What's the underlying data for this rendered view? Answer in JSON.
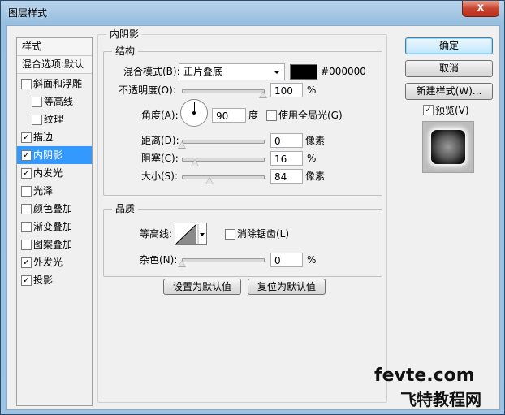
{
  "window": {
    "title": "图层样式",
    "close_label": "x"
  },
  "style_list": {
    "header": "样式",
    "blend_options": "混合选项:默认",
    "items": [
      {
        "label": "斜面和浮雕",
        "checked": false,
        "indent": false,
        "selected": false
      },
      {
        "label": "等高线",
        "checked": false,
        "indent": true,
        "selected": false
      },
      {
        "label": "纹理",
        "checked": false,
        "indent": true,
        "selected": false
      },
      {
        "label": "描边",
        "checked": true,
        "indent": false,
        "selected": false
      },
      {
        "label": "内阴影",
        "checked": true,
        "indent": false,
        "selected": true
      },
      {
        "label": "内发光",
        "checked": true,
        "indent": false,
        "selected": false
      },
      {
        "label": "光泽",
        "checked": false,
        "indent": false,
        "selected": false
      },
      {
        "label": "颜色叠加",
        "checked": false,
        "indent": false,
        "selected": false
      },
      {
        "label": "渐变叠加",
        "checked": false,
        "indent": false,
        "selected": false
      },
      {
        "label": "图案叠加",
        "checked": false,
        "indent": false,
        "selected": false
      },
      {
        "label": "外发光",
        "checked": true,
        "indent": false,
        "selected": false
      },
      {
        "label": "投影",
        "checked": true,
        "indent": false,
        "selected": false
      }
    ]
  },
  "panel": {
    "title": "内阴影",
    "structure": {
      "title": "结构",
      "blend_mode_label": "混合模式(B):",
      "blend_mode_value": "正片叠底",
      "color_hex_label": "#000000",
      "color": "#000000",
      "opacity_label": "不透明度(O):",
      "opacity_value": "100",
      "opacity_fraction": 1.0,
      "percent": "%",
      "angle_label": "角度(A):",
      "angle_value": "90",
      "degree_unit": "度",
      "global_light_label": "使用全局光(G)",
      "global_light_checked": false,
      "distance_label": "距离(D):",
      "distance_value": "0",
      "distance_fraction": 0.0,
      "pixel_unit": "像素",
      "choke_label": "阻塞(C):",
      "choke_value": "16",
      "choke_fraction": 0.16,
      "size_label": "大小(S):",
      "size_value": "84",
      "size_fraction": 0.34
    },
    "quality": {
      "title": "品质",
      "contour_label": "等高线:",
      "antialias_label": "消除锯齿(L)",
      "antialias_checked": false,
      "noise_label": "杂色(N):",
      "noise_value": "0",
      "noise_fraction": 0.0,
      "percent": "%"
    },
    "make_default_label": "设置为默认值",
    "reset_default_label": "复位为默认值"
  },
  "actions": {
    "ok_label": "确定",
    "cancel_label": "取消",
    "new_style_label": "新建样式(W)...",
    "preview_label": "预览(V)",
    "preview_checked": true
  },
  "watermark": {
    "line1": "fevte.com",
    "line2": "飞特教程网"
  }
}
